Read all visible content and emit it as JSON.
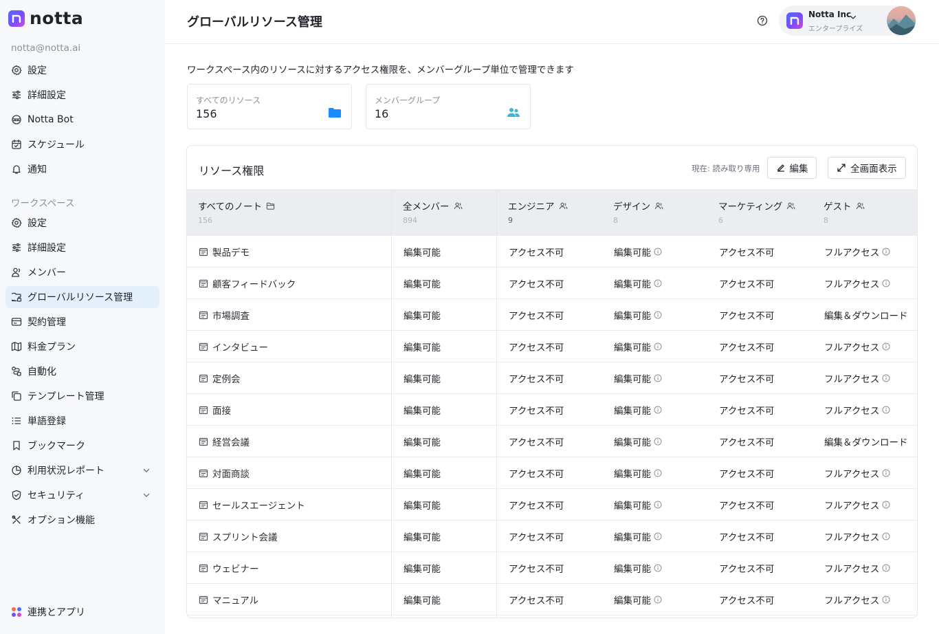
{
  "sidebar": {
    "logo_text": "notta",
    "email": "notta@notta.ai",
    "account_items": [
      {
        "label": "設定",
        "icon": "gear-icon"
      },
      {
        "label": "詳細設定",
        "icon": "sliders-icon"
      },
      {
        "label": "Notta Bot",
        "icon": "bot-icon"
      },
      {
        "label": "スケジュール",
        "icon": "calendar-icon"
      },
      {
        "label": "通知",
        "icon": "bell-icon"
      }
    ],
    "workspace_label": "ワークスペース",
    "workspace_items": [
      {
        "label": "設定",
        "icon": "gear-icon"
      },
      {
        "label": "詳細設定",
        "icon": "sliders-icon"
      },
      {
        "label": "メンバー",
        "icon": "user-icon"
      },
      {
        "label": "グローバルリソース管理",
        "icon": "folder-lock-icon",
        "active": true
      },
      {
        "label": "契約管理",
        "icon": "contract-icon"
      },
      {
        "label": "料金プラン",
        "icon": "map-icon"
      },
      {
        "label": "自動化",
        "icon": "automation-icon"
      },
      {
        "label": "テンプレート管理",
        "icon": "template-icon"
      },
      {
        "label": "単語登録",
        "icon": "list-icon"
      },
      {
        "label": "ブックマーク",
        "icon": "bookmark-icon"
      },
      {
        "label": "利用状況レポート",
        "icon": "chart-pie-icon",
        "expandable": true
      },
      {
        "label": "セキュリティ",
        "icon": "shield-icon",
        "expandable": true
      },
      {
        "label": "オプション機能",
        "icon": "tools-icon"
      }
    ],
    "integrations_label": "連携とアプリ"
  },
  "header": {
    "title": "グローバルリソース管理",
    "account_name": "Notta Inc",
    "account_plan": "エンタープライズ"
  },
  "main": {
    "description": "ワークスペース内のリソースに対するアクセス権限を、メンバーグループ単位で管理できます",
    "stats": [
      {
        "label": "すべてのリソース",
        "value": "156",
        "icon": "folder-icon"
      },
      {
        "label": "メンバーグループ",
        "value": "16",
        "icon": "group-icon"
      }
    ]
  },
  "panel": {
    "title": "リソース権限",
    "status": "現在: 読み取り専用",
    "edit_label": "編集",
    "fullscreen_label": "全画面表示",
    "columns": [
      {
        "title": "すべてのノート",
        "count": "156"
      },
      {
        "title": "全メンバー",
        "count": "894"
      },
      {
        "title": "エンジニア",
        "count": "9"
      },
      {
        "title": "デザイン",
        "count": "8"
      },
      {
        "title": "マーケティング",
        "count": "6"
      },
      {
        "title": "ゲスト",
        "count": "8"
      }
    ],
    "rows": [
      {
        "name": "製品デモ",
        "all": "編集可能",
        "eng": "アクセス不可",
        "design": "編集可能",
        "mkt": "アクセス不可",
        "guest": "フルアクセス"
      },
      {
        "name": "顧客フィードバック",
        "all": "編集可能",
        "eng": "アクセス不可",
        "design": "編集可能",
        "mkt": "アクセス不可",
        "guest": "フルアクセス"
      },
      {
        "name": "市場調査",
        "all": "編集可能",
        "eng": "アクセス不可",
        "design": "編集可能",
        "mkt": "アクセス不可",
        "guest": "編集＆ダウンロード"
      },
      {
        "name": "インタビュー",
        "all": "編集可能",
        "eng": "アクセス不可",
        "design": "編集可能",
        "mkt": "アクセス不可",
        "guest": "フルアクセス"
      },
      {
        "name": "定例会",
        "all": "編集可能",
        "eng": "アクセス不可",
        "design": "編集可能",
        "mkt": "アクセス不可",
        "guest": "フルアクセス"
      },
      {
        "name": "面接",
        "all": "編集可能",
        "eng": "アクセス不可",
        "design": "編集可能",
        "mkt": "アクセス不可",
        "guest": "フルアクセス"
      },
      {
        "name": "経営会議",
        "all": "編集可能",
        "eng": "アクセス不可",
        "design": "編集可能",
        "mkt": "アクセス不可",
        "guest": "編集＆ダウンロード"
      },
      {
        "name": "対面商談",
        "all": "編集可能",
        "eng": "アクセス不可",
        "design": "編集可能",
        "mkt": "アクセス不可",
        "guest": "フルアクセス"
      },
      {
        "name": "セールスエージェント",
        "all": "編集可能",
        "eng": "アクセス不可",
        "design": "編集可能",
        "mkt": "アクセス不可",
        "guest": "フルアクセス"
      },
      {
        "name": "スプリント会議",
        "all": "編集可能",
        "eng": "アクセス不可",
        "design": "編集可能",
        "mkt": "アクセス不可",
        "guest": "フルアクセス"
      },
      {
        "name": "ウェビナー",
        "all": "編集可能",
        "eng": "アクセス不可",
        "design": "編集可能",
        "mkt": "アクセス不可",
        "guest": "フルアクセス"
      },
      {
        "name": "マニュアル",
        "all": "編集可能",
        "eng": "アクセス不可",
        "design": "編集可能",
        "mkt": "アクセス不可",
        "guest": "フルアクセス"
      }
    ]
  },
  "colors": {
    "accent": "#1a8cff",
    "active_nav_bg": "#e3f0fc",
    "group_icon": "#3bb8c9"
  }
}
